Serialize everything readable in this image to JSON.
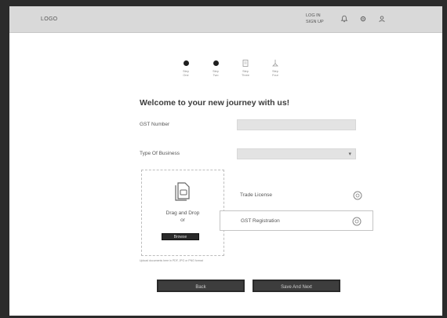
{
  "header": {
    "logo": "LOGO",
    "auth_line1": "LOG IN",
    "auth_line2": "SIGN UP",
    "icons": [
      "bell-icon",
      "settings-icon",
      "user-icon"
    ]
  },
  "stepper": {
    "steps": [
      {
        "label_line1": "Step",
        "label_line2": "One",
        "state": "done",
        "icon": "filled-dot"
      },
      {
        "label_line1": "Step",
        "label_line2": "Two",
        "state": "done",
        "icon": "filled-dot"
      },
      {
        "label_line1": "Step",
        "label_line2": "Three",
        "state": "todo",
        "icon": "document-icon"
      },
      {
        "label_line1": "Step",
        "label_line2": "Four",
        "state": "todo",
        "icon": "flag-icon"
      }
    ]
  },
  "form": {
    "heading": "Welcome to your new journey with us!",
    "gst_label": "GST Number",
    "gst_value": "",
    "business_label": "Type Of Business",
    "business_value": ""
  },
  "upload": {
    "drag_line1": "Drag and Drop",
    "drag_line2": "or",
    "browse_label": "Browse",
    "note": "Upload documents here in PDF, JPG or PNG format"
  },
  "documents": [
    {
      "name": "Trade License",
      "icon": "info-circle-icon",
      "selected": false
    },
    {
      "name": "GST Registration",
      "icon": "info-circle-icon",
      "selected": true
    }
  ],
  "actions": {
    "back_label": "Back",
    "save_label": "Save And Next"
  }
}
